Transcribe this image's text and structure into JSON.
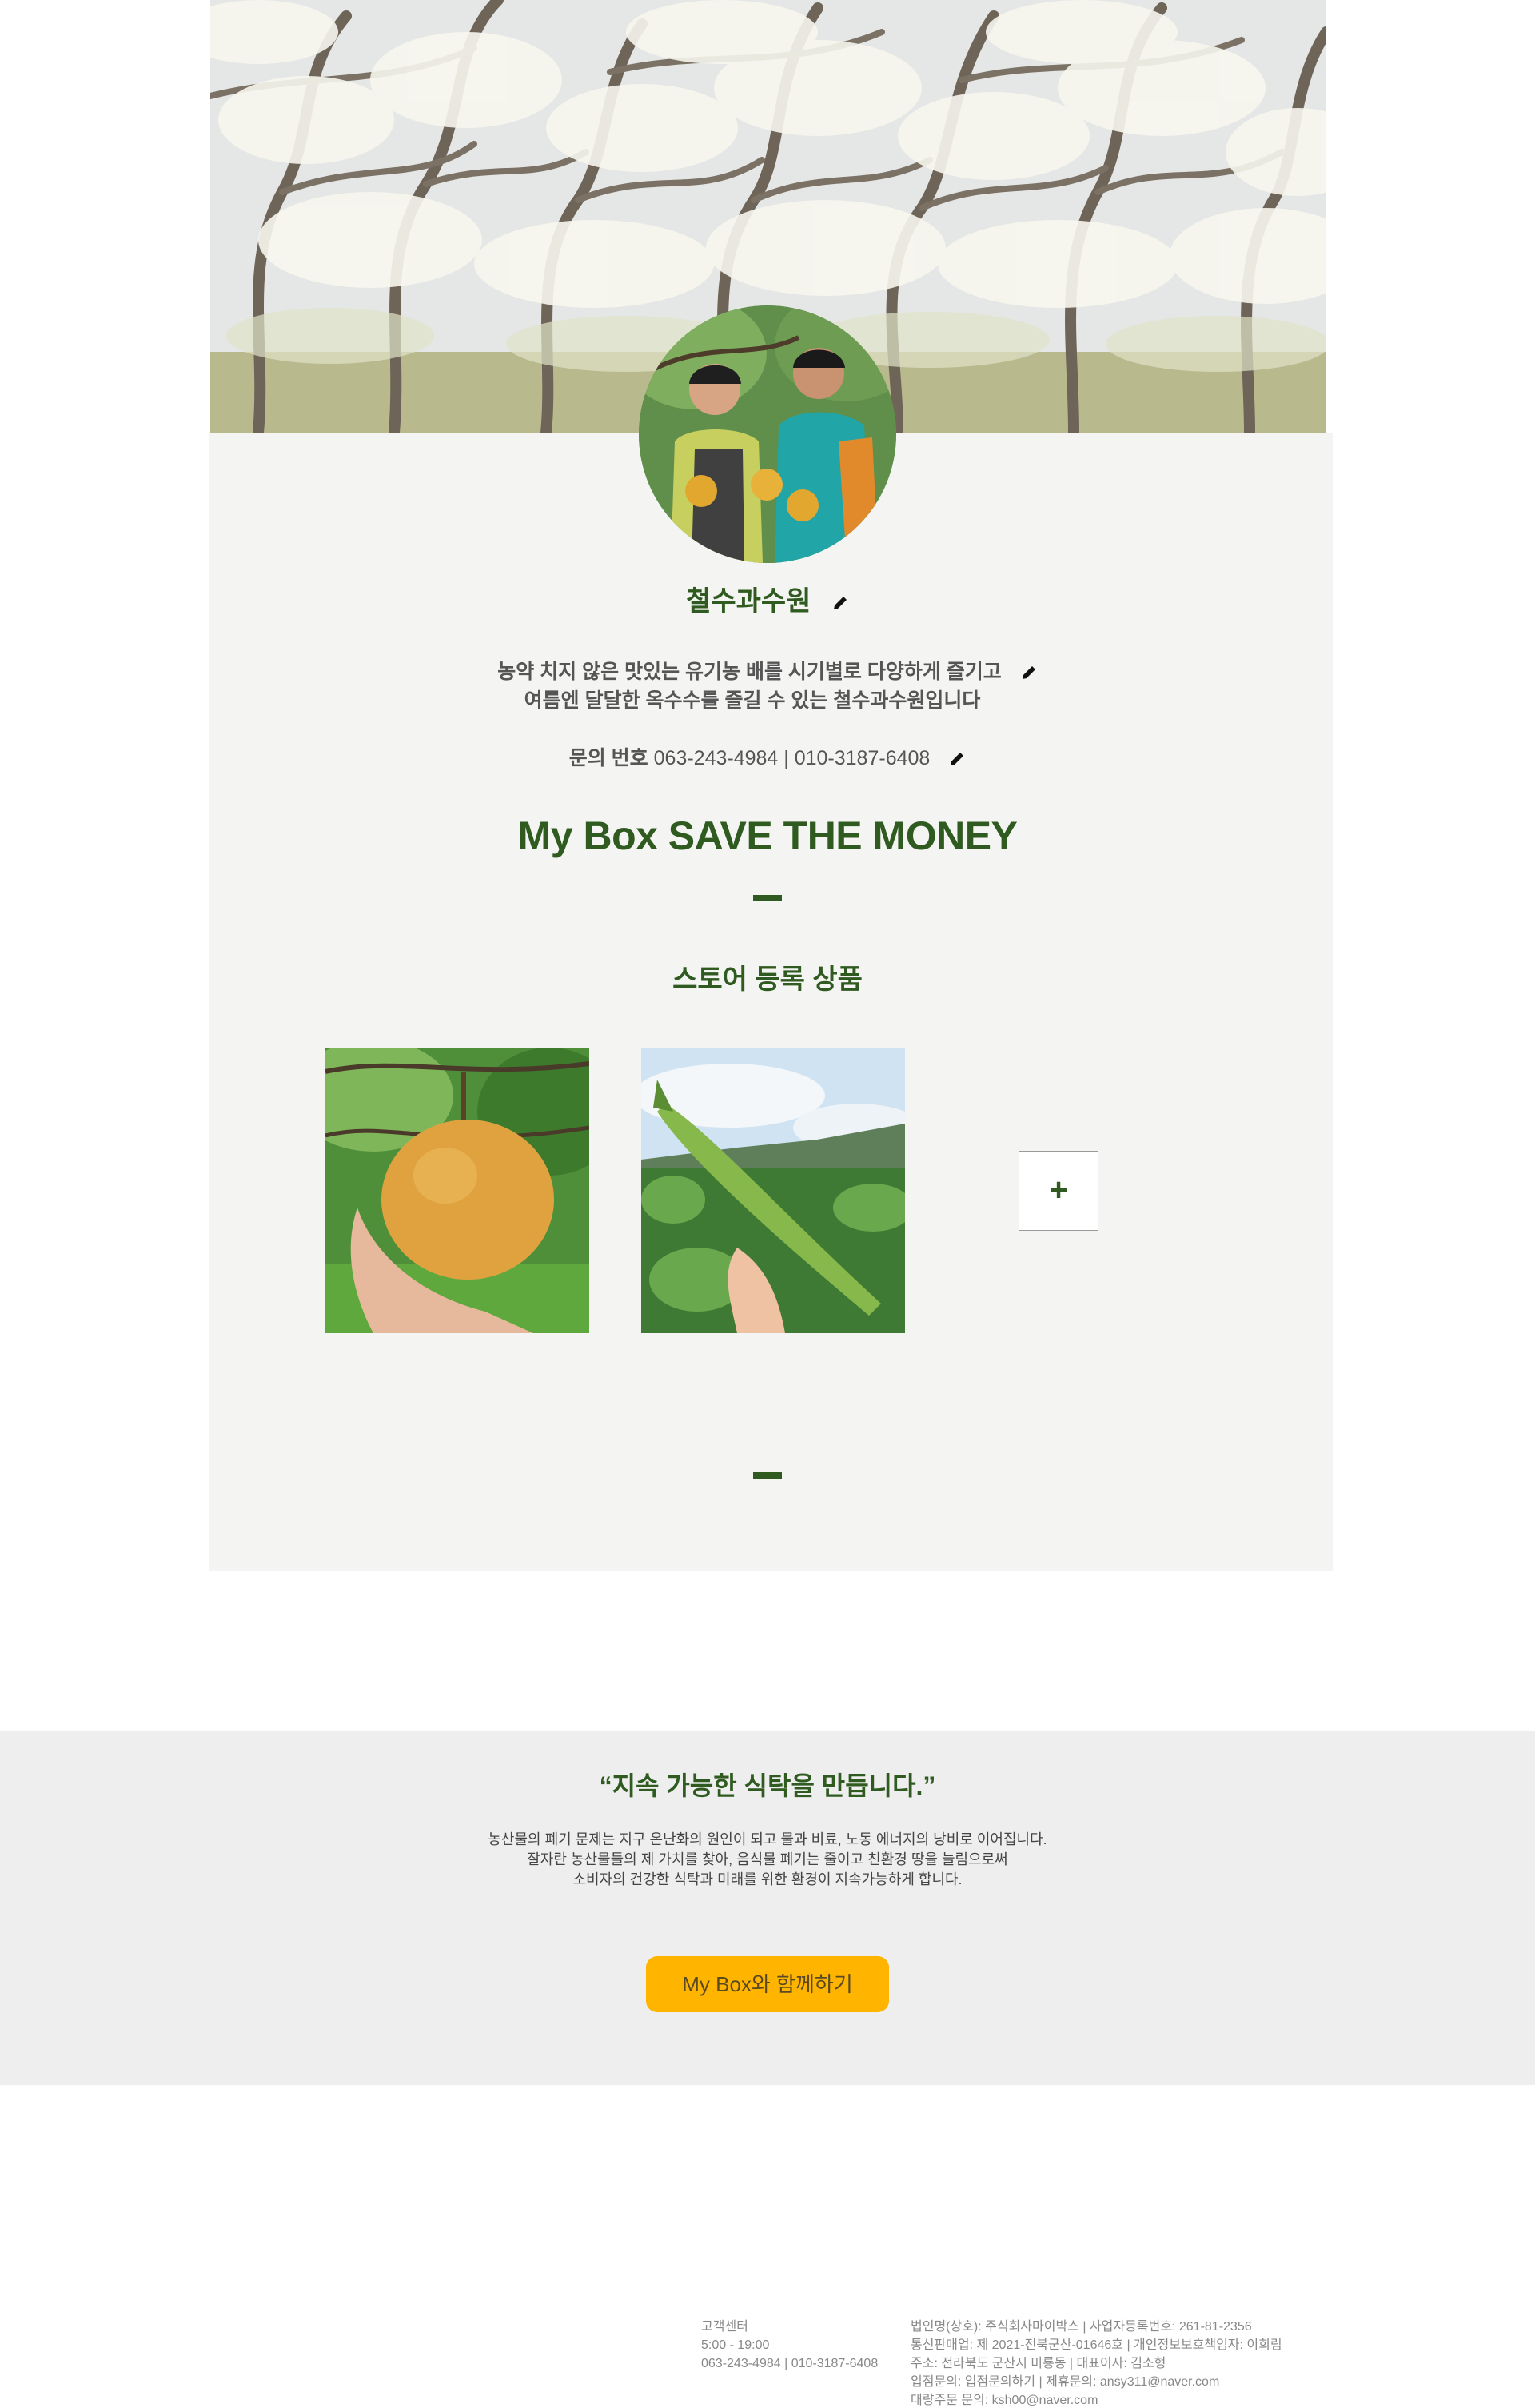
{
  "profile": {
    "farm_name": "철수과수원",
    "description_line1": "농약 치지 않은 맛있는 유기농 배를 시기별로 다양하게 즐기고",
    "description_line2": "여름엔 달달한 옥수수를 즐길 수 있는 철수과수원입니다",
    "contact_label": "문의 번호",
    "contact_numbers": "063-243-4984 | 010-3187-6408"
  },
  "store": {
    "tagline": "My Box SAVE THE MONEY",
    "section_title": "스토어 등록 상품",
    "add_label": "+",
    "products": [
      {
        "icon": "pear-photo"
      },
      {
        "icon": "corn-photo"
      }
    ]
  },
  "mission": {
    "quote": "“지속 가능한 식탁을 만듭니다.”",
    "body_line1": "농산물의 폐기 문제는 지구 온난화의 원인이 되고 물과 비료, 노동 에너지의 낭비로 이어집니다.",
    "body_line2": "잘자란 농산물들의 제 가치를 찾아, 음식물 폐기는 줄이고 친환경 땅을 늘림으로써",
    "body_line3": "소비자의 건강한 식탁과 미래를 위한 환경이 지속가능하게 합니다.",
    "cta_label": "My Box와 함께하기"
  },
  "footer": {
    "cs_title": "고객센터",
    "cs_hours": "5:00 - 19:00",
    "cs_phone": "063-243-4984 | 010-3187-6408",
    "company_line1": "법인명(상호): 주식회사마이박스 | 사업자등록번호: 261-81-2356",
    "company_line2": "통신판매업: 제 2021-전북군산-01646호 | 개인정보보호책임자: 이희림",
    "company_line3": "주소: 전라북도 군산시 미룡동 | 대표이사: 김소형",
    "company_line4": "입점문의: 입점문의하기 | 제휴문의: ansy311@naver.com",
    "company_line5": "대량주문 문의: ksh00@naver.com"
  },
  "colors": {
    "brand_green": "#2f5a20",
    "panel_bg": "#f4f5f2",
    "mission_bg": "#eeeeee",
    "cta_yellow": "#ffb400"
  }
}
